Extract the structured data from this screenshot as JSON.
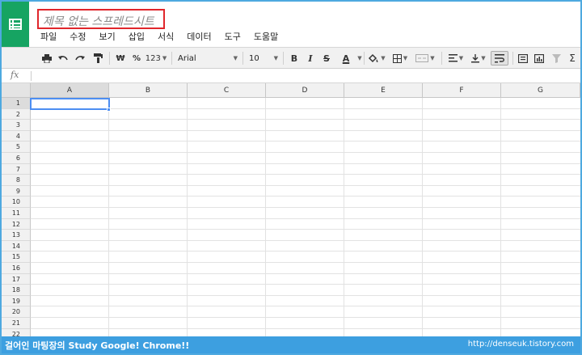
{
  "document": {
    "title": "제목 없는 스프레드시트"
  },
  "menu": [
    "파일",
    "수정",
    "보기",
    "삽입",
    "서식",
    "데이터",
    "도구",
    "도움말"
  ],
  "toolbar": {
    "currency": "₩",
    "percent": "%",
    "number_format": "123",
    "font": "Arial",
    "font_size": "10",
    "bold": "B",
    "italic": "I",
    "strike": "S",
    "text_color": "A"
  },
  "formula_bar": {
    "fx_label": "fx"
  },
  "grid": {
    "columns": [
      "A",
      "B",
      "C",
      "D",
      "E",
      "F",
      "G"
    ],
    "rows": [
      "1",
      "2",
      "3",
      "4",
      "5",
      "6",
      "7",
      "8",
      "9",
      "10",
      "11",
      "12",
      "13",
      "14",
      "15",
      "16",
      "17",
      "18",
      "19",
      "20",
      "21",
      "22"
    ],
    "active_cell": "A1"
  },
  "footer": {
    "left_text": "걸어인 마팅장의 Study Google! Chrome!!",
    "right_text": "http://denseuk.tistory.com"
  },
  "colors": {
    "logo": "#16a462",
    "title_highlight": "#e0262b",
    "selection": "#4d8ef2",
    "footer": "#3d9fe0",
    "text_color_bar": "#000000"
  }
}
